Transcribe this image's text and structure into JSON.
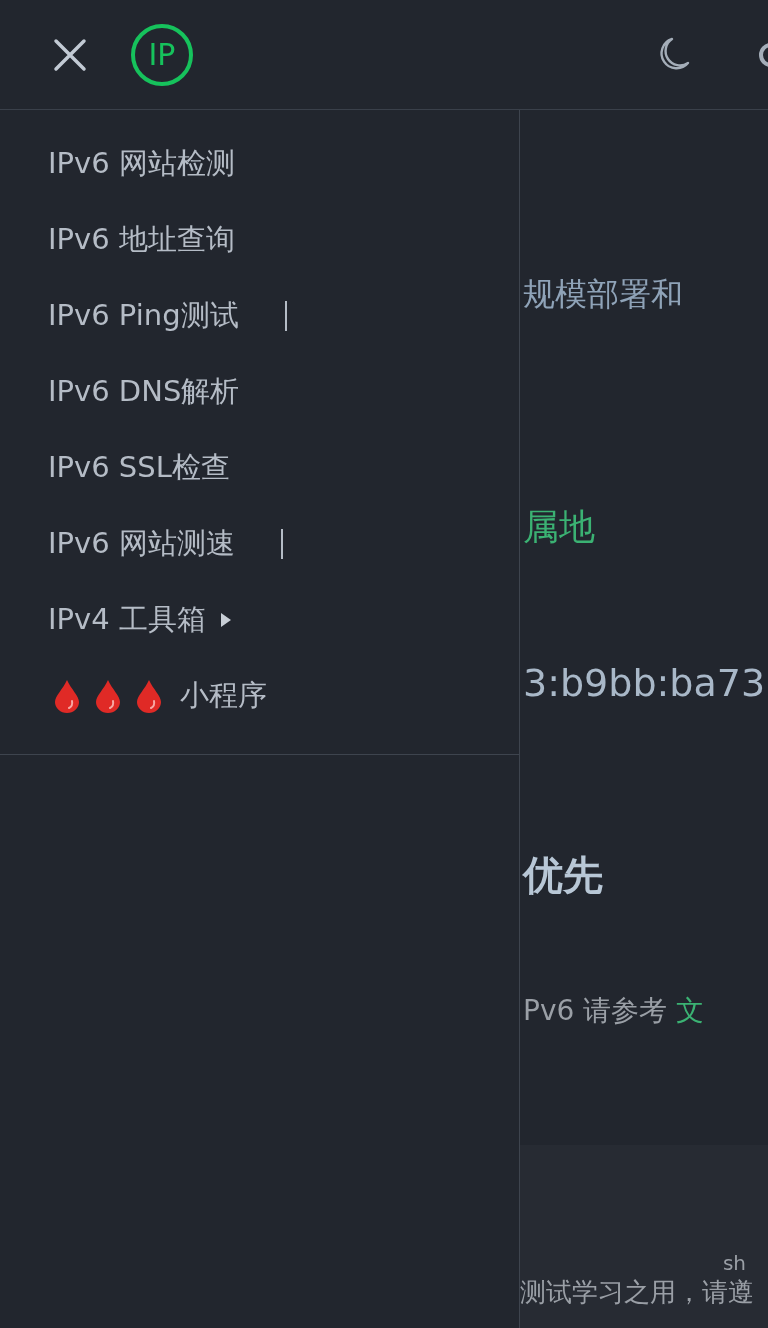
{
  "header": {
    "logo": "IP"
  },
  "drawer": {
    "items": [
      {
        "label": "IPv6 网站检测",
        "kind": "link",
        "divider": false,
        "submenu": false
      },
      {
        "label": "IPv6 地址查询",
        "kind": "link",
        "divider": false,
        "submenu": false
      },
      {
        "label": "IPv6 Ping测试",
        "kind": "link",
        "divider": true,
        "submenu": false
      },
      {
        "label": "IPv6 DNS解析",
        "kind": "link",
        "divider": false,
        "submenu": false
      },
      {
        "label": "IPv6 SSL检查",
        "kind": "link",
        "divider": false,
        "submenu": false
      },
      {
        "label": "IPv6 网站测速",
        "kind": "link",
        "divider": true,
        "submenu": false
      },
      {
        "label": "IPv4 工具箱",
        "kind": "link",
        "divider": false,
        "submenu": true
      },
      {
        "label": "小程序",
        "kind": "drops",
        "divider": false,
        "submenu": false
      }
    ]
  },
  "content": {
    "blocks": [
      {
        "kind": "text",
        "text": "规模部署和"
      },
      {
        "kind": "accent",
        "text": "属地"
      },
      {
        "kind": "address",
        "text": "3:b9bb:ba73"
      },
      {
        "kind": "heading",
        "text": "优先"
      },
      {
        "kind": "note",
        "text": "Pv6 请参考",
        "link": "文"
      }
    ]
  },
  "footer": {
    "lines": [
      {
        "kind": "small",
        "text": "sh"
      },
      {
        "kind": "text",
        "text": "测试学习之用，请遵"
      }
    ]
  }
}
